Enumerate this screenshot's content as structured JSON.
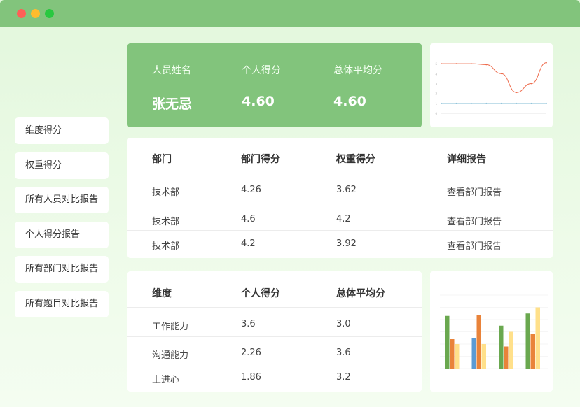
{
  "sidebar": {
    "items": [
      {
        "label": "维度得分"
      },
      {
        "label": "权重得分"
      },
      {
        "label": "所有人员对比报告"
      },
      {
        "label": "个人得分报告"
      },
      {
        "label": "所有部门对比报告"
      },
      {
        "label": "所有题目对比报告"
      }
    ]
  },
  "summary": {
    "name_label": "人员姓名",
    "name_value": "张无忌",
    "score_label": "个人得分",
    "score_value": "4.60",
    "avg_label": "总体平均分",
    "avg_value": "4.60"
  },
  "dept_table": {
    "headers": [
      "部门",
      "部门得分",
      "权重得分",
      "详细报告"
    ],
    "rows": [
      [
        "技术部",
        "4.26",
        "3.62",
        "查看部门报告"
      ],
      [
        "技术部",
        "4.6",
        "4.2",
        "查看部门报告"
      ],
      [
        "技术部",
        "4.2",
        "3.92",
        "查看部门报告"
      ]
    ]
  },
  "dim_table": {
    "headers": [
      "维度",
      "个人得分",
      "总体平均分"
    ],
    "rows": [
      [
        "工作能力",
        "3.6",
        "3.0"
      ],
      [
        "沟通能力",
        "2.26",
        "3.6"
      ],
      [
        "上进心",
        "1.86",
        "3.2"
      ]
    ]
  },
  "colors": {
    "accent": "#82c47c",
    "line_red": "#ee6c4d",
    "line_blue": "#5aa7c9",
    "bar_green": "#6aa84f",
    "bar_orange": "#e9833a",
    "bar_blue": "#5b9bd5",
    "bar_yellow": "#ffe08a"
  },
  "chart_data": [
    {
      "type": "line",
      "series": [
        {
          "values": [
            5,
            5,
            5,
            4.9,
            4,
            2.1,
            3,
            5.1
          ]
        },
        {
          "values": [
            1,
            1,
            1,
            1,
            1,
            1,
            1,
            1
          ]
        }
      ],
      "ylim": [
        0,
        5.5
      ],
      "y_ticks": [
        "5",
        "4",
        "3",
        "2",
        "1",
        "0"
      ],
      "grid": false
    },
    {
      "type": "bar",
      "categories": [
        "1",
        "2",
        "3",
        "4"
      ],
      "series": [
        {
          "values": [
            4.3,
            0,
            3.5,
            4.5
          ]
        },
        {
          "values": [
            0,
            2.5,
            0,
            0
          ]
        },
        {
          "values": [
            2.4,
            4.4,
            1.8,
            2.8
          ]
        },
        {
          "values": [
            2.0,
            2.0,
            3.0,
            5.0
          ]
        }
      ],
      "ylim": [
        0,
        6
      ],
      "grid": true
    }
  ]
}
